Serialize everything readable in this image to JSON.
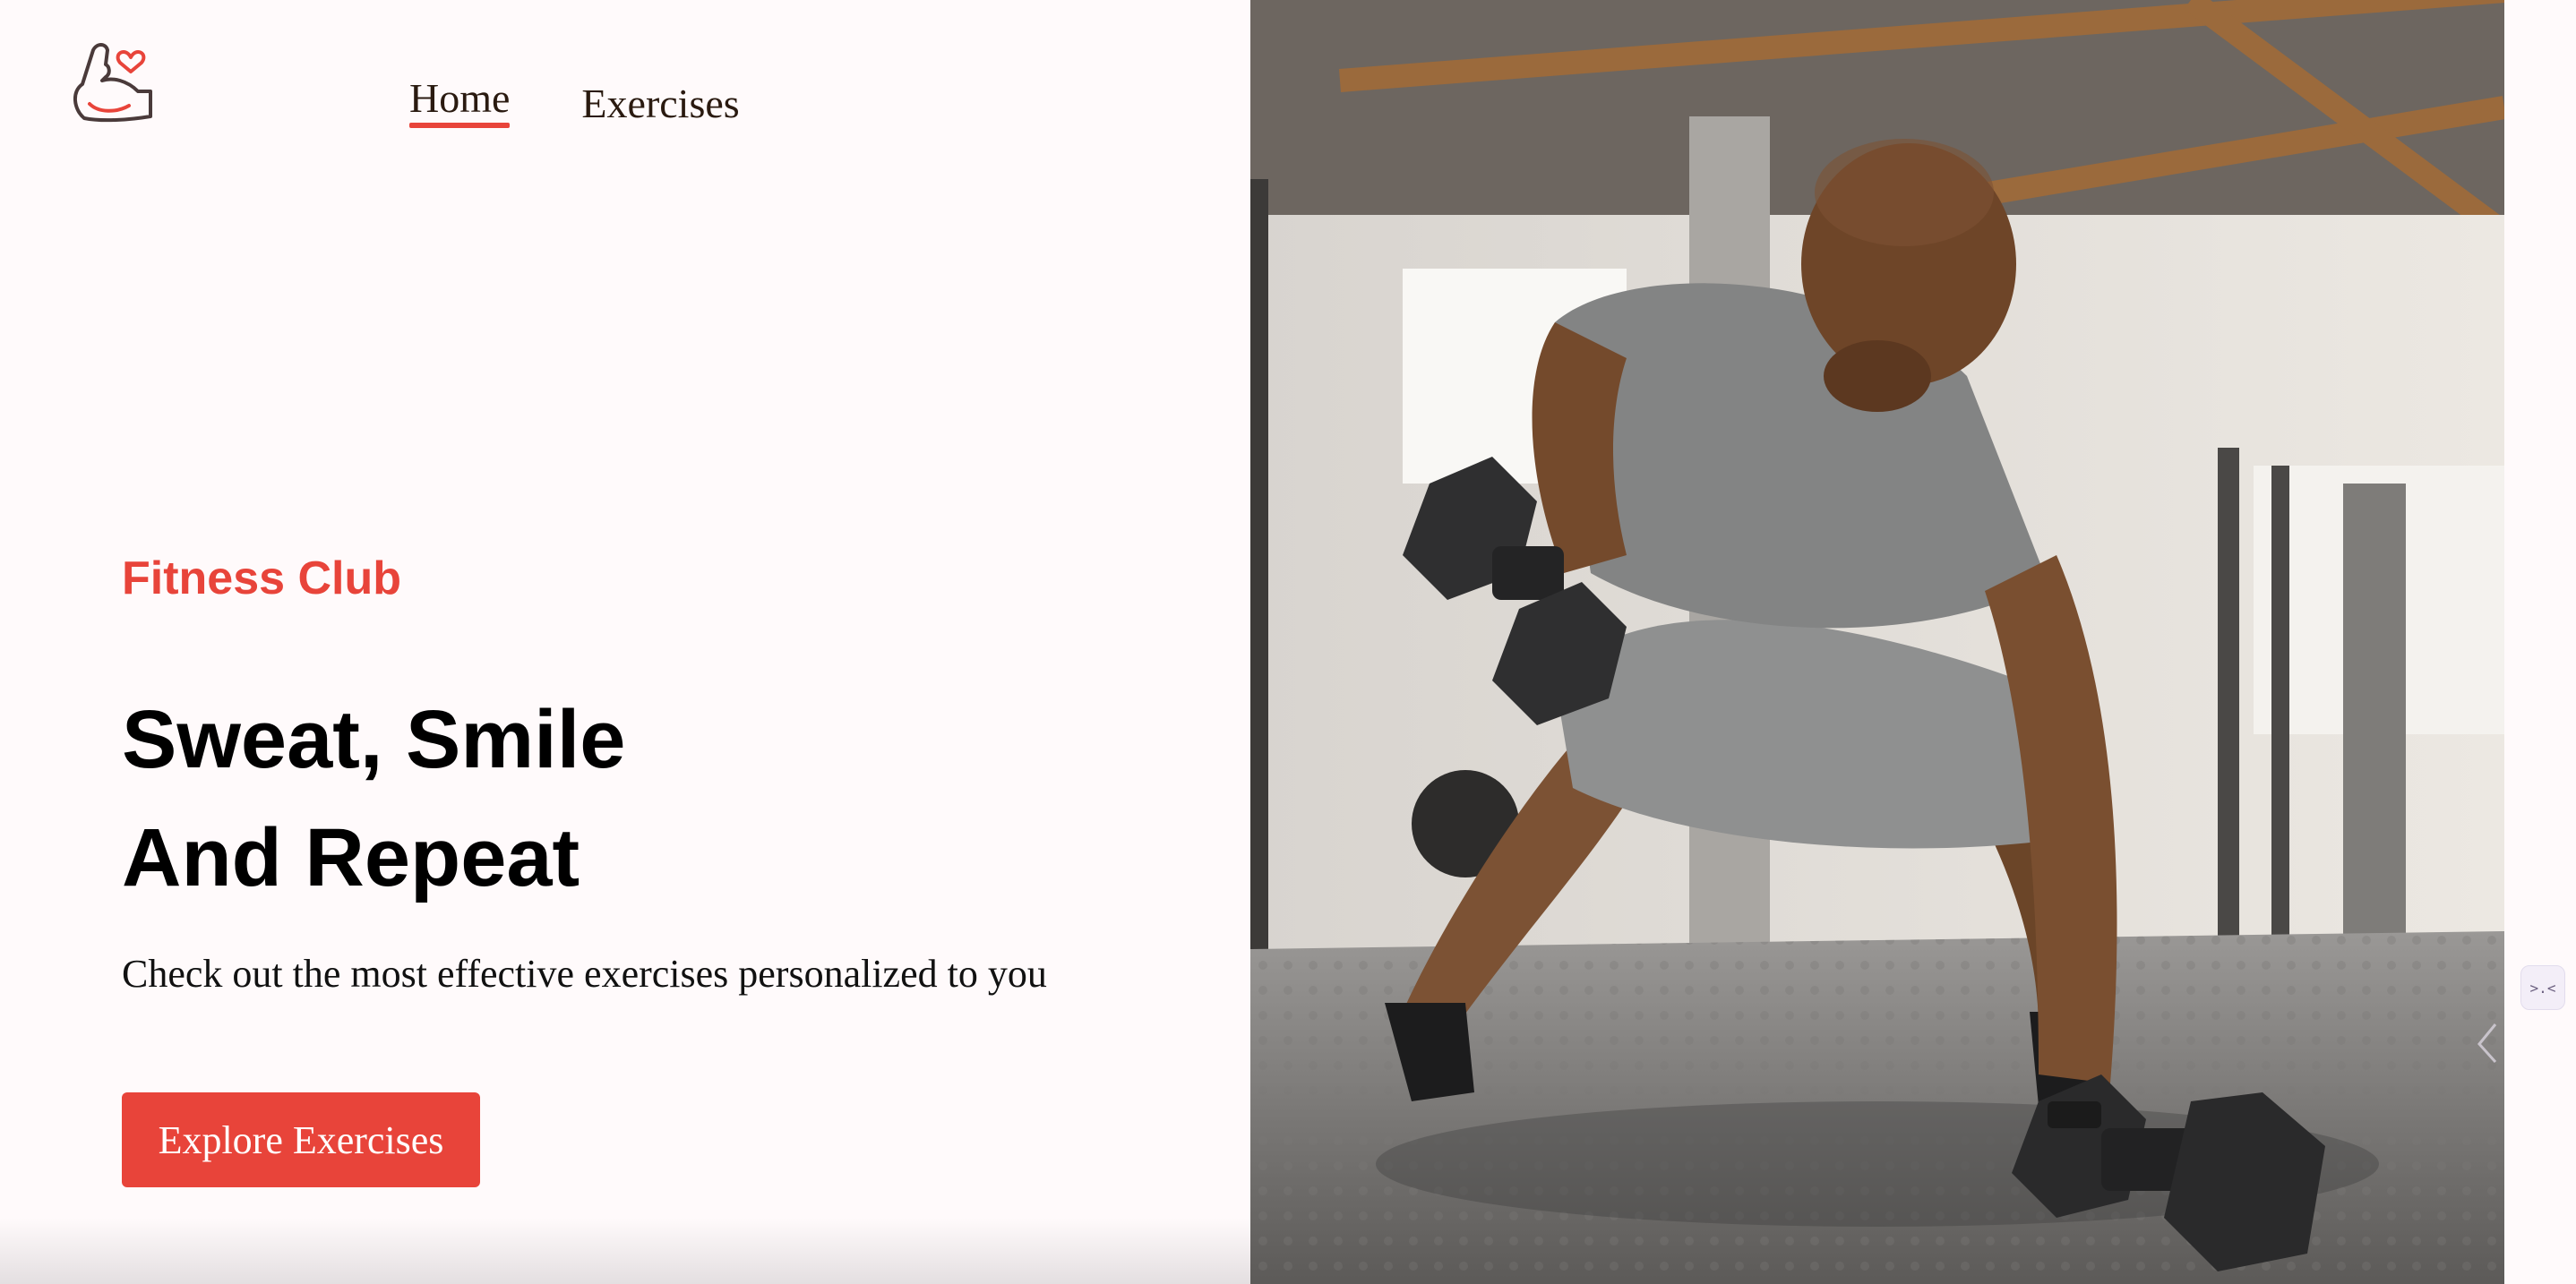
{
  "nav": {
    "logo_icon": "flexed-arm-heart-icon",
    "links": [
      {
        "label": "Home",
        "active": true
      },
      {
        "label": "Exercises",
        "active": false
      }
    ]
  },
  "hero": {
    "eyebrow": "Fitness Club",
    "headline_line1": "Sweat, Smile",
    "headline_line2": "And Repeat",
    "subtitle": "Check out the most effective exercises personalized to you",
    "cta_label": "Explore Exercises",
    "image_alt": "man-doing-dumbbell-rows-in-gym-photo"
  },
  "side_widget": {
    "icon": "dev-tools-icon",
    "label": ">.<"
  },
  "colors": {
    "accent": "#e8443a",
    "background": "#fffafb",
    "text": "#111111",
    "button_text": "#ffffff"
  }
}
